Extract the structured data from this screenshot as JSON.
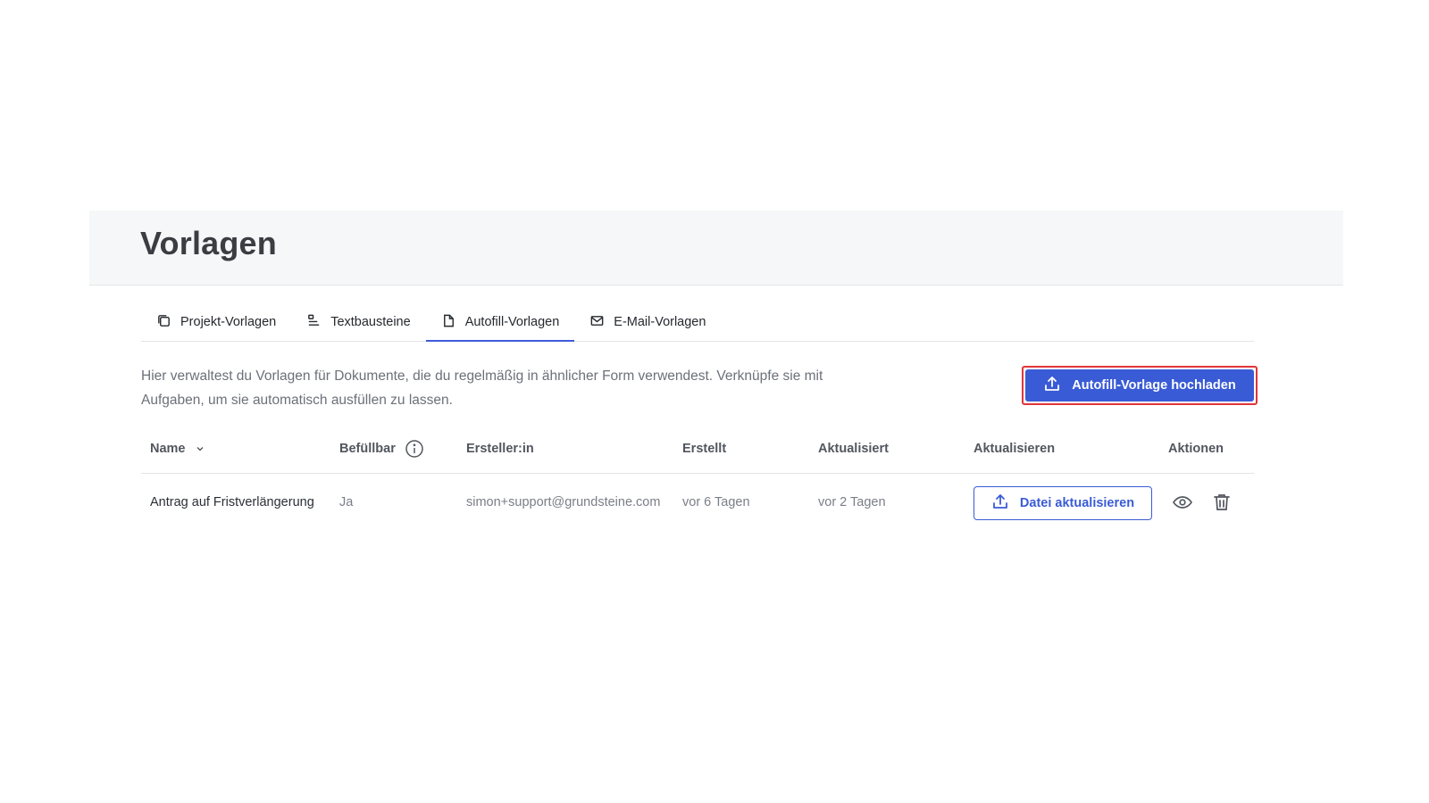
{
  "page": {
    "title": "Vorlagen"
  },
  "tabs": [
    {
      "label": "Projekt-Vorlagen",
      "icon": "copy-icon",
      "active": false
    },
    {
      "label": "Textbausteine",
      "icon": "text-block-icon",
      "active": false
    },
    {
      "label": "Autofill-Vorlagen",
      "icon": "document-icon",
      "active": true
    },
    {
      "label": "E-Mail-Vorlagen",
      "icon": "mail-icon",
      "active": false
    }
  ],
  "description": "Hier verwaltest du Vorlagen für Dokumente, die du regelmäßig in ähnlicher Form verwendest. Verknüpfe sie mit Aufgaben, um sie automatisch ausfüllen zu lassen.",
  "upload_button": {
    "label": "Autofill-Vorlage hochladen",
    "icon": "upload-icon"
  },
  "table": {
    "columns": {
      "name": "Name",
      "fillable": "Befüllbar",
      "creator": "Ersteller:in",
      "created": "Erstellt",
      "updated": "Aktualisiert",
      "update": "Aktualisieren",
      "actions": "Aktionen"
    },
    "rows": [
      {
        "name": "Antrag auf Fristverlängerung",
        "fillable": "Ja",
        "creator": "simon+support@grundsteine.com",
        "created": "vor 6 Tagen",
        "updated": "vor 2 Tagen",
        "update_button": "Datei aktualisieren"
      }
    ]
  },
  "colors": {
    "accent": "#3a5bd6",
    "highlight_border": "#e0353a",
    "header_background": "#f6f7f9"
  }
}
